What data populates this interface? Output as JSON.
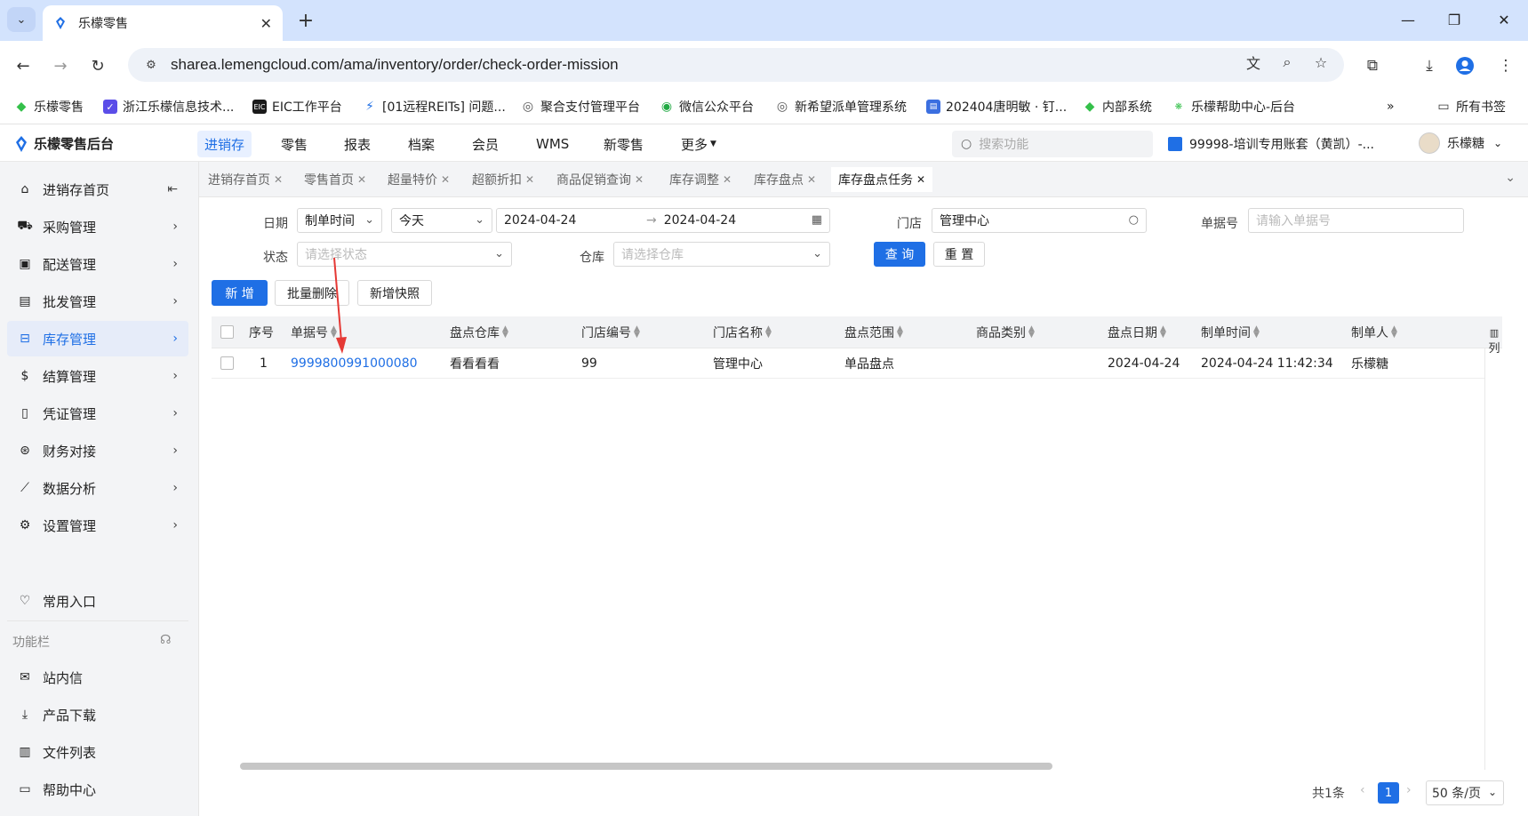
{
  "browser": {
    "tab_title": "乐檬零售",
    "url": "sharea.lemengcloud.com/ama/inventory/order/check-order-mission",
    "bookmarks": [
      "乐檬零售",
      "浙江乐檬信息技术...",
      "EIC工作平台",
      "[01远程REITs] 问题...",
      "聚合支付管理平台",
      "微信公众平台",
      "新希望派单管理系统",
      "202404唐明敏 · 钉...",
      "内部系统",
      "乐檬帮助中心-后台"
    ],
    "all_bookmarks": "所有书签"
  },
  "app": {
    "logo": "乐檬零售后台",
    "topnav": [
      "进销存",
      "零售",
      "报表",
      "档案",
      "会员",
      "WMS",
      "新零售",
      "更多"
    ],
    "search_placeholder": "搜索功能",
    "account": "99998-培训专用账套（黄凯）-...",
    "user": "乐檬糖"
  },
  "sidebar": {
    "items": [
      "进销存首页",
      "采购管理",
      "配送管理",
      "批发管理",
      "库存管理",
      "结算管理",
      "凭证管理",
      "财务对接",
      "数据分析",
      "设置管理"
    ],
    "common": "常用入口",
    "section": "功能栏",
    "tools": [
      "站内信",
      "产品下载",
      "文件列表",
      "帮助中心"
    ]
  },
  "page_tabs": [
    "进销存首页",
    "零售首页",
    "超量特价",
    "超额折扣",
    "商品促销查询",
    "库存调整",
    "库存盘点",
    "库存盘点任务"
  ],
  "filters": {
    "date_label": "日期",
    "date_type": "制单时间",
    "date_range": "今天",
    "date_start": "2024-04-24",
    "date_end": "2024-04-24",
    "store_label": "门店",
    "store_value": "管理中心",
    "docno_label": "单据号",
    "docno_placeholder": "请输入单据号",
    "status_label": "状态",
    "status_placeholder": "请选择状态",
    "warehouse_label": "仓库",
    "warehouse_placeholder": "请选择仓库",
    "query": "查 询",
    "reset": "重 置"
  },
  "actions": {
    "add": "新 增",
    "batch_delete": "批量删除",
    "add_snapshot": "新增快照"
  },
  "table": {
    "headers": [
      "序号",
      "单据号",
      "盘点仓库",
      "门店编号",
      "门店名称",
      "盘点范围",
      "商品类别",
      "盘点日期",
      "制单时间",
      "制单人"
    ],
    "rows": [
      {
        "seq": "1",
        "docno": "9999800991000080",
        "warehouse": "看看看看",
        "store_code": "99",
        "store_name": "管理中心",
        "scope": "单品盘点",
        "category": "",
        "check_date": "2024-04-24",
        "created_at": "2024-04-24 11:42:34",
        "creator": "乐檬糖"
      }
    ],
    "column_setting": "列"
  },
  "pagination": {
    "total": "共1条",
    "current": "1",
    "page_size": "50 条/页"
  }
}
